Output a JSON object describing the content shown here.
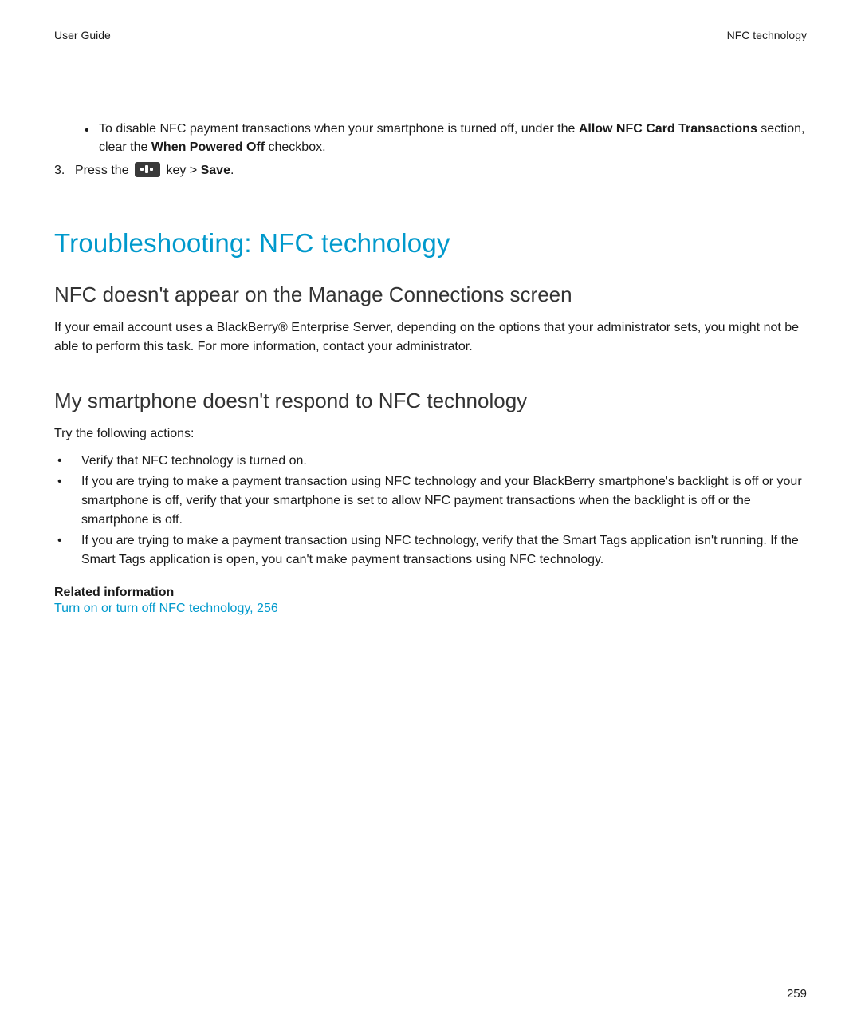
{
  "header": {
    "left": "User Guide",
    "right": "NFC technology"
  },
  "continuation": {
    "bullet_prefix": "To disable NFC payment transactions when your smartphone is turned off, under the ",
    "bold1": "Allow NFC Card Transactions",
    "mid1": " section, clear the ",
    "bold2": "When Powered Off",
    "suffix1": " checkbox.",
    "step3": {
      "number": "3.",
      "pre": "Press the ",
      "post_key": " key > ",
      "save": "Save",
      "end": "."
    }
  },
  "h1": "Troubleshooting: NFC technology",
  "section1": {
    "heading": "NFC doesn't appear on the Manage Connections screen",
    "body": "If your email account uses a BlackBerry® Enterprise Server, depending on the options that your administrator sets, you might not be able to perform this task. For more information, contact your administrator."
  },
  "section2": {
    "heading": "My smartphone doesn't respond to NFC technology",
    "intro": "Try the following actions:",
    "items": [
      "Verify that NFC technology is turned on.",
      "If you are trying to make a payment transaction using NFC technology and your BlackBerry smartphone's backlight is off or your smartphone is off, verify that your smartphone is set to allow NFC payment transactions when the backlight is off or the smartphone is off.",
      "If you are trying to make a payment transaction using NFC technology, verify that the Smart Tags application isn't running. If the Smart Tags application is open, you can't make payment transactions using NFC technology."
    ]
  },
  "related": {
    "label": "Related information",
    "link": "Turn on or turn off NFC technology, 256"
  },
  "page_number": "259",
  "bullet_char": "•"
}
